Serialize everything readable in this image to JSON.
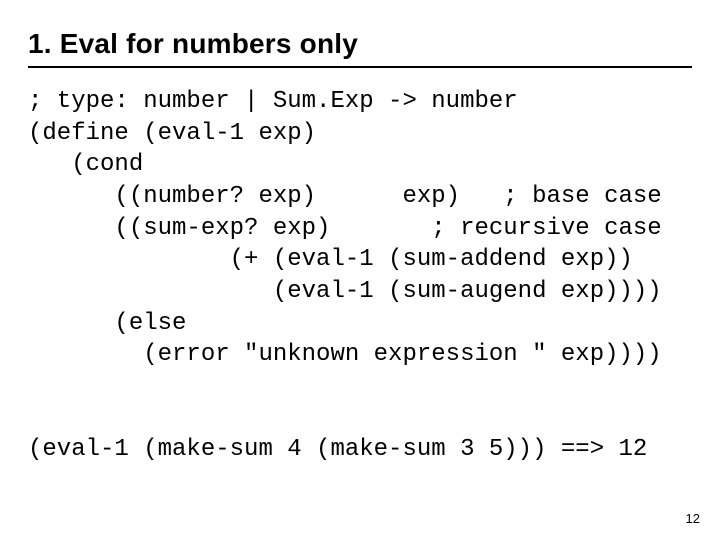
{
  "title": "1. Eval for numbers only",
  "code": {
    "l1": "; type: number | Sum.Exp -> number",
    "l2": "(define (eval-1 exp)",
    "l3": "   (cond",
    "l4": "      ((number? exp)      exp)   ; base case",
    "l5": "      ((sum-exp? exp)       ; recursive case",
    "l6": "              (+ (eval-1 (sum-addend exp))",
    "l7": "                 (eval-1 (sum-augend exp))))",
    "l8": "      (else",
    "l9": "        (error \"unknown expression \" exp))))",
    "l10": "",
    "l11": "",
    "l12": "(eval-1 (make-sum 4 (make-sum 3 5))) ==> 12"
  },
  "pagenum": "12"
}
